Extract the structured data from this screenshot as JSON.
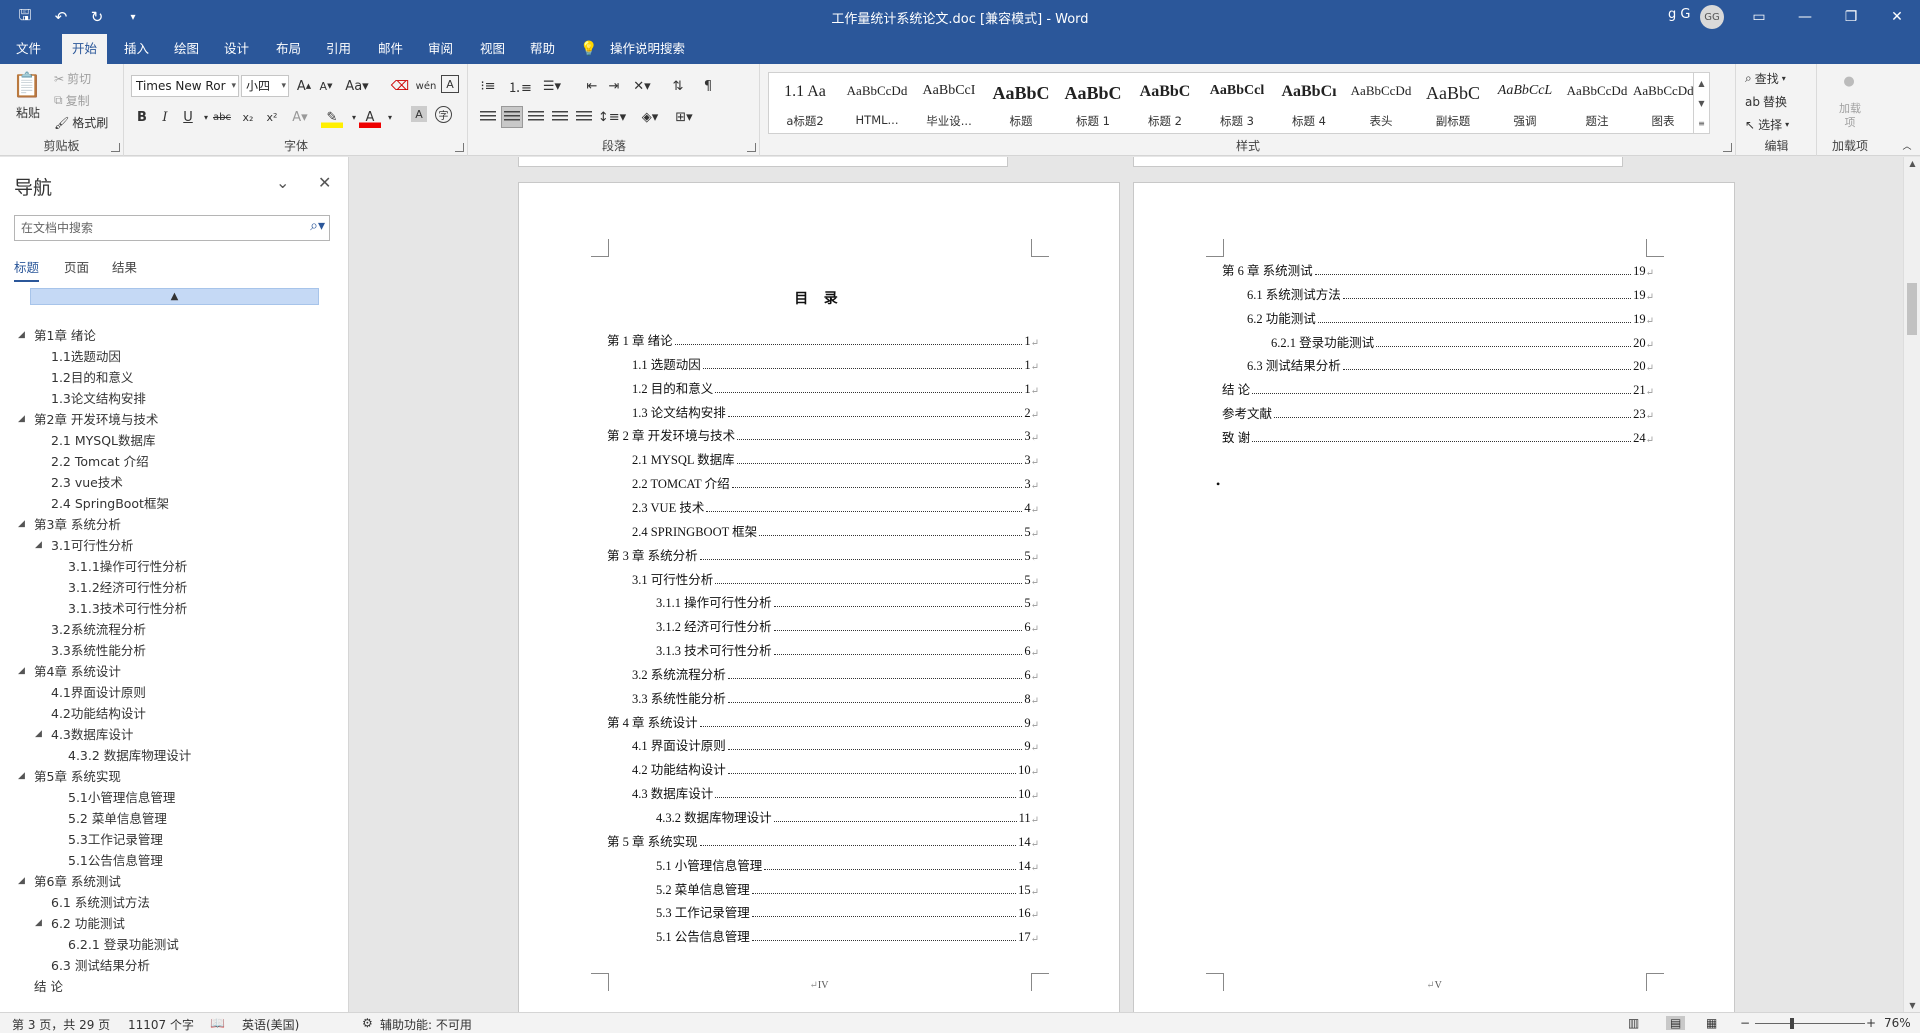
{
  "app": {
    "title": "工作量统计系统论文.doc [兼容模式]  -  Word",
    "user_name": "g G",
    "user_initials": "GG"
  },
  "colors": {
    "brand": "#2b579a",
    "ribbon_bg": "#f3f3f3",
    "doc_bg": "#e6e6e6"
  },
  "quick_access": {
    "icons": [
      "save-icon",
      "undo-icon",
      "redo-icon",
      "customize-icon"
    ]
  },
  "tabs": [
    "文件",
    "开始",
    "插入",
    "绘图",
    "设计",
    "布局",
    "引用",
    "邮件",
    "审阅",
    "视图",
    "帮助"
  ],
  "tell_me": "操作说明搜索",
  "ribbon": {
    "clipboard": {
      "paste": "粘贴",
      "cut": "剪切",
      "copy": "复制",
      "format_painter": "格式刷",
      "label": "剪贴板"
    },
    "font": {
      "name": "Times New Ror",
      "size": "小四",
      "label": "字体"
    },
    "paragraph": {
      "label": "段落"
    },
    "styles": {
      "label": "样式",
      "items": [
        {
          "preview": "1.1  Aa",
          "name": "a标题2"
        },
        {
          "preview": "AaBbCcDd",
          "name": "HTML..."
        },
        {
          "preview": "AaBbCcI",
          "name": "毕业设..."
        },
        {
          "preview": "AaBbC",
          "name": "标题"
        },
        {
          "preview": "AaBbC",
          "name": "标题 1"
        },
        {
          "preview": "AaBbC",
          "name": "标题 2"
        },
        {
          "preview": "AaBbCcl",
          "name": "标题 3"
        },
        {
          "preview": "AaBbCı",
          "name": "标题 4"
        },
        {
          "preview": "AaBbCcDd",
          "name": "表头"
        },
        {
          "preview": "AaBbC",
          "name": "副标题"
        },
        {
          "preview": "AaBbCcL",
          "name": "强调"
        },
        {
          "preview": "AaBbCcDd",
          "name": "题注"
        },
        {
          "preview": "AaBbCcDd",
          "name": "图表"
        }
      ]
    },
    "editing": {
      "find": "查找",
      "replace": "替换",
      "select": "选择",
      "label": "编辑"
    },
    "addins": {
      "button": "加载项",
      "label": "加载项"
    }
  },
  "nav": {
    "title": "导航",
    "search_placeholder": "在文档中搜索",
    "tabs": [
      "标题",
      "页面",
      "结果"
    ],
    "collapse": "▲",
    "items": [
      {
        "text": "第1章 绪论",
        "level": 1,
        "arrow": true
      },
      {
        "text": "1.1选题动因",
        "level": 2,
        "arrow": false
      },
      {
        "text": "1.2目的和意义",
        "level": 2,
        "arrow": false
      },
      {
        "text": "1.3论文结构安排",
        "level": 2,
        "arrow": false
      },
      {
        "text": "第2章 开发环境与技术",
        "level": 1,
        "arrow": true
      },
      {
        "text": "2.1 MYSQL数据库",
        "level": 2,
        "arrow": false
      },
      {
        "text": "2.2 Tomcat 介绍",
        "level": 2,
        "arrow": false
      },
      {
        "text": "2.3 vue技术",
        "level": 2,
        "arrow": false
      },
      {
        "text": "2.4 SpringBoot框架",
        "level": 2,
        "arrow": false
      },
      {
        "text": "第3章 系统分析",
        "level": 1,
        "arrow": true
      },
      {
        "text": "3.1可行性分析",
        "level": 2,
        "arrow": true
      },
      {
        "text": "3.1.1操作可行性分析",
        "level": 3,
        "arrow": false
      },
      {
        "text": "3.1.2经济可行性分析",
        "level": 3,
        "arrow": false
      },
      {
        "text": "3.1.3技术可行性分析",
        "level": 3,
        "arrow": false
      },
      {
        "text": "3.2系统流程分析",
        "level": 2,
        "arrow": false
      },
      {
        "text": "3.3系统性能分析",
        "level": 2,
        "arrow": false
      },
      {
        "text": "第4章 系统设计",
        "level": 1,
        "arrow": true
      },
      {
        "text": "4.1界面设计原则",
        "level": 2,
        "arrow": false
      },
      {
        "text": "4.2功能结构设计",
        "level": 2,
        "arrow": false
      },
      {
        "text": "4.3数据库设计",
        "level": 2,
        "arrow": true
      },
      {
        "text": "4.3.2 数据库物理设计",
        "level": 3,
        "arrow": false
      },
      {
        "text": "第5章 系统实现",
        "level": 1,
        "arrow": true
      },
      {
        "text": "5.1小管理信息管理",
        "level": 3,
        "arrow": false
      },
      {
        "text": "5.2 菜单信息管理",
        "level": 3,
        "arrow": false
      },
      {
        "text": "5.3工作记录管理",
        "level": 3,
        "arrow": false
      },
      {
        "text": "5.1公告信息管理",
        "level": 3,
        "arrow": false
      },
      {
        "text": "第6章 系统测试",
        "level": 1,
        "arrow": true
      },
      {
        "text": "6.1 系统测试方法",
        "level": 2,
        "arrow": false
      },
      {
        "text": "6.2 功能测试",
        "level": 2,
        "arrow": true
      },
      {
        "text": "6.2.1 登录功能测试",
        "level": 3,
        "arrow": false
      },
      {
        "text": "6.3 测试结果分析",
        "level": 2,
        "arrow": false
      },
      {
        "text": "结  论",
        "level": 1,
        "arrow": false
      }
    ]
  },
  "page_left": {
    "title": "目  录",
    "footer": "IV",
    "lines": [
      {
        "text": "第 1 章  绪论",
        "page": "1",
        "level": 1
      },
      {
        "text": "1.1 选题动因",
        "page": "1",
        "level": 2
      },
      {
        "text": "1.2 目的和意义",
        "page": "1",
        "level": 2
      },
      {
        "text": "1.3 论文结构安排",
        "page": "2",
        "level": 2
      },
      {
        "text": "第 2 章  开发环境与技术",
        "page": "3",
        "level": 1
      },
      {
        "text": "2.1 MYSQL 数据库",
        "page": "3",
        "level": 2
      },
      {
        "text": "2.2 TOMCAT 介绍",
        "page": "3",
        "level": 2
      },
      {
        "text": "2.3 VUE 技术",
        "page": "4",
        "level": 2
      },
      {
        "text": "2.4 SPRINGBOOT 框架",
        "page": "5",
        "level": 2
      },
      {
        "text": "第 3 章  系统分析",
        "page": "5",
        "level": 1
      },
      {
        "text": "3.1 可行性分析",
        "page": "5",
        "level": 2
      },
      {
        "text": "3.1.1 操作可行性分析",
        "page": "5",
        "level": 3
      },
      {
        "text": "3.1.2 经济可行性分析",
        "page": "6",
        "level": 3
      },
      {
        "text": "3.1.3 技术可行性分析",
        "page": "6",
        "level": 3
      },
      {
        "text": "3.2 系统流程分析",
        "page": "6",
        "level": 2
      },
      {
        "text": "3.3 系统性能分析",
        "page": "8",
        "level": 2
      },
      {
        "text": "第 4 章  系统设计",
        "page": "9",
        "level": 1
      },
      {
        "text": "4.1 界面设计原则",
        "page": "9",
        "level": 2
      },
      {
        "text": "4.2 功能结构设计",
        "page": "10",
        "level": 2
      },
      {
        "text": "4.3 数据库设计",
        "page": "10",
        "level": 2
      },
      {
        "text": "4.3.2  数据库物理设计",
        "page": "11",
        "level": 3
      },
      {
        "text": "第 5 章  系统实现",
        "page": "14",
        "level": 1
      },
      {
        "text": "5.1 小管理信息管理",
        "page": "14",
        "level": 3
      },
      {
        "text": "5.2  菜单信息管理",
        "page": "15",
        "level": 3
      },
      {
        "text": "5.3 工作记录管理",
        "page": "16",
        "level": 3
      },
      {
        "text": "5.1 公告信息管理",
        "page": "17",
        "level": 3
      }
    ]
  },
  "page_right": {
    "footer": "V",
    "lines": [
      {
        "text": "第 6 章  系统测试",
        "page": "19",
        "level": 1
      },
      {
        "text": "6.1 系统测试方法",
        "page": "19",
        "level": 2
      },
      {
        "text": "6.2 功能测试",
        "page": "19",
        "level": 2
      },
      {
        "text": "6.2.1  登录功能测试",
        "page": "20",
        "level": 3
      },
      {
        "text": "6.3  测试结果分析",
        "page": "20",
        "level": 2
      },
      {
        "text": "结   论",
        "page": "21",
        "level": 1
      },
      {
        "text": "参考文献",
        "page": "23",
        "level": 1
      },
      {
        "text": "致   谢",
        "page": "24",
        "level": 1
      }
    ],
    "bullet": "•"
  },
  "status": {
    "page": "第 3 页，共 29 页",
    "words": "11107 个字",
    "language": "英语(美国)",
    "accessibility": "辅助功能: 不可用",
    "zoom": "76%",
    "zoom_minus": "−",
    "zoom_plus": "+"
  }
}
